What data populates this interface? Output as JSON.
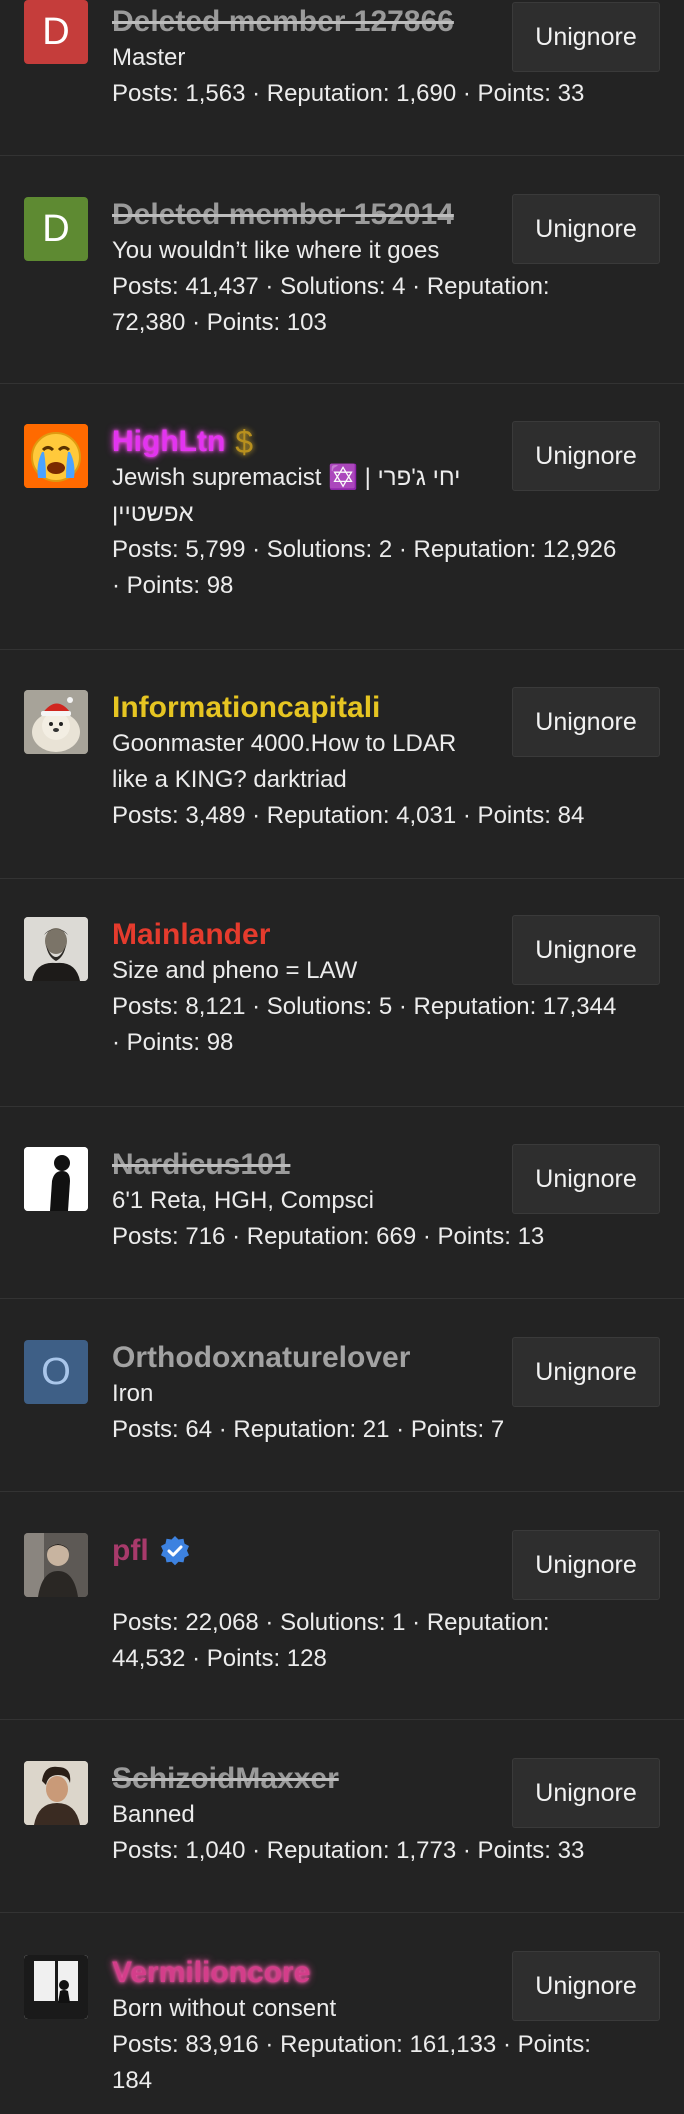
{
  "ignored_users": [
    {
      "avatar": {
        "type": "letter",
        "letter": "D",
        "bg": "#c53d3b"
      },
      "username": "Deleted member 127866",
      "username_style": "deleted",
      "title": "Master",
      "stats": [
        "Posts: 1,563 · Reputation: 1,690 · Points: 33"
      ],
      "button": "Unignore"
    },
    {
      "avatar": {
        "type": "letter",
        "letter": "D",
        "bg": "#5e8a32"
      },
      "username": "Deleted member 152014",
      "username_style": "deleted",
      "title": "You wouldn’t like where it goes",
      "stats": [
        "Posts: 41,437 · Solutions: 4 · Reputation:",
        "72,380 · Points: 103"
      ],
      "button": "Unignore"
    },
    {
      "avatar": {
        "type": "image",
        "icon": "crying-face-avatar"
      },
      "username": "HighLtn",
      "username_style": "magenta-glow",
      "badge_icon": "dollar-sign-icon",
      "title": "Jewish supremacist ✡️ | יחי ג'פרי",
      "title_line2": "אפשטיין",
      "stats": [
        "Posts: 5,799 · Solutions: 2 · Reputation: 12,926",
        "· Points: 98"
      ],
      "button": "Unignore"
    },
    {
      "avatar": {
        "type": "image",
        "icon": "santa-dog-avatar"
      },
      "username": "Informationcapitali",
      "username_style": "gold",
      "title": "Goonmaster 4000.How to LDAR",
      "title_line2": "like a KING? darktriad",
      "stats": [
        "Posts: 3,489 · Reputation: 4,031 · Points: 84"
      ],
      "button": "Unignore"
    },
    {
      "avatar": {
        "type": "image",
        "icon": "bearded-man-portrait-avatar"
      },
      "username": "Mainlander",
      "username_style": "red",
      "title": "Size and pheno = LAW",
      "stats": [
        "Posts: 8,121 · Solutions: 5 · Reputation: 17,344",
        "· Points: 98"
      ],
      "button": "Unignore"
    },
    {
      "avatar": {
        "type": "image",
        "icon": "silhouette-avatar"
      },
      "username": "Nardicus101",
      "username_style": "deleted",
      "title": "6'1 Reta, HGH, Compsci",
      "stats": [
        "Posts: 716 · Reputation: 669 · Points: 13"
      ],
      "button": "Unignore"
    },
    {
      "avatar": {
        "type": "letter",
        "letter": "O",
        "bg": "#3e5f86"
      },
      "username": "Orthodoxnaturelover",
      "username_style": "grey",
      "title": "Iron",
      "stats": [
        "Posts: 64 · Reputation: 21 · Points: 7"
      ],
      "button": "Unignore"
    },
    {
      "avatar": {
        "type": "image",
        "icon": "man-photo-avatar"
      },
      "username": "pfl",
      "username_style": "purple-red",
      "badge_icon": "verified-check-icon",
      "title": "",
      "stats": [
        "Posts: 22,068 · Solutions: 1 · Reputation:",
        "44,532 · Points: 128"
      ],
      "button": "Unignore"
    },
    {
      "avatar": {
        "type": "image",
        "icon": "man-portrait-avatar"
      },
      "username": "SchizoidMaxxer",
      "username_style": "deleted",
      "title": "Banned",
      "stats": [
        "Posts: 1,040 · Reputation: 1,773 · Points: 33"
      ],
      "button": "Unignore"
    },
    {
      "avatar": {
        "type": "image",
        "icon": "window-silhouette-avatar"
      },
      "username": "Vermilioncore",
      "username_style": "pink-glow",
      "title": "Born without consent",
      "stats": [
        "Posts: 83,916 · Reputation: 161,133 · Points:",
        "184"
      ],
      "button": "Unignore"
    }
  ]
}
